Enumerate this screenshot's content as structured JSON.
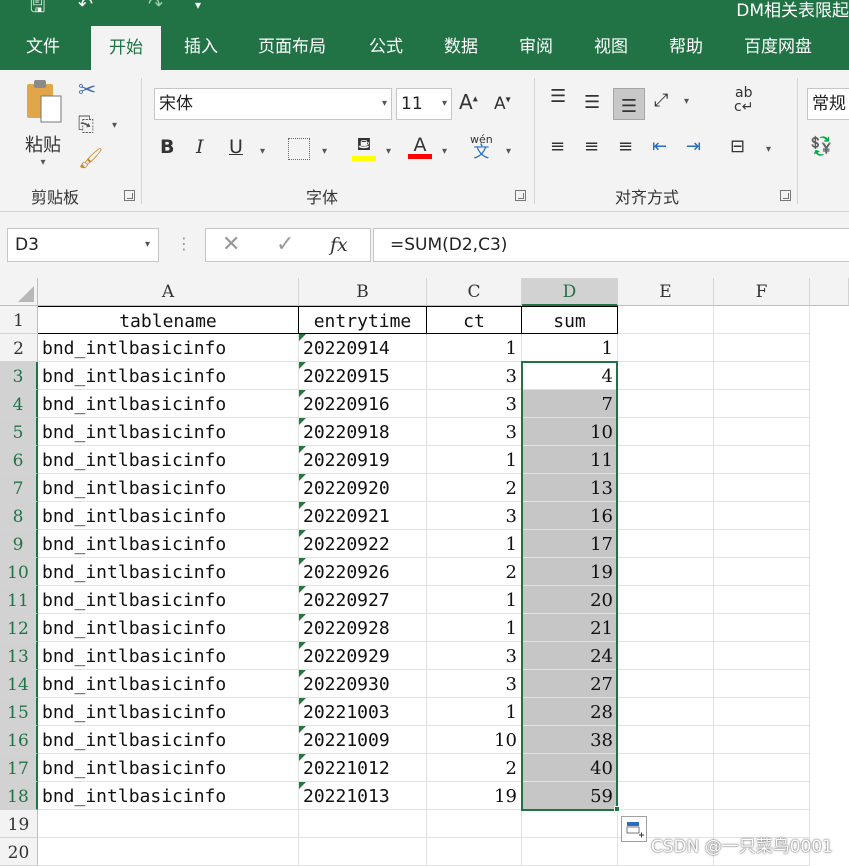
{
  "titlebar": {
    "title": "DM相关表限起"
  },
  "tabs": [
    "文件",
    "开始",
    "插入",
    "页面布局",
    "公式",
    "数据",
    "审阅",
    "视图",
    "帮助",
    "百度网盘"
  ],
  "active_tab": "开始",
  "ribbon": {
    "clipboard": {
      "paste_label": "粘贴",
      "group_label": "剪贴板"
    },
    "font": {
      "font_name": "宋体",
      "font_size": "11",
      "group_label": "字体",
      "phonetic": "wén",
      "phonetic_char": "文"
    },
    "alignment": {
      "group_label": "对齐方式"
    },
    "number": {
      "format": "常规"
    },
    "colors": {
      "accent": "#217346",
      "highlight": "#ffff00",
      "font_color": "#ff0000"
    }
  },
  "formula_bar": {
    "name_box": "D3",
    "formula": "=SUM(D2,C3)",
    "fx_label": "fx"
  },
  "columns": [
    "A",
    "B",
    "C",
    "D",
    "E",
    "F"
  ],
  "selected_column": "D",
  "headers": [
    "tablename",
    "entrytime",
    "ct",
    "sum"
  ],
  "rows": [
    [
      "bnd_intlbasicinfo",
      "20220914",
      "1",
      "1"
    ],
    [
      "bnd_intlbasicinfo",
      "20220915",
      "3",
      "4"
    ],
    [
      "bnd_intlbasicinfo",
      "20220916",
      "3",
      "7"
    ],
    [
      "bnd_intlbasicinfo",
      "20220918",
      "3",
      "10"
    ],
    [
      "bnd_intlbasicinfo",
      "20220919",
      "1",
      "11"
    ],
    [
      "bnd_intlbasicinfo",
      "20220920",
      "2",
      "13"
    ],
    [
      "bnd_intlbasicinfo",
      "20220921",
      "3",
      "16"
    ],
    [
      "bnd_intlbasicinfo",
      "20220922",
      "1",
      "17"
    ],
    [
      "bnd_intlbasicinfo",
      "20220926",
      "2",
      "19"
    ],
    [
      "bnd_intlbasicinfo",
      "20220927",
      "1",
      "20"
    ],
    [
      "bnd_intlbasicinfo",
      "20220928",
      "1",
      "21"
    ],
    [
      "bnd_intlbasicinfo",
      "20220929",
      "3",
      "24"
    ],
    [
      "bnd_intlbasicinfo",
      "20220930",
      "3",
      "27"
    ],
    [
      "bnd_intlbasicinfo",
      "20221003",
      "1",
      "28"
    ],
    [
      "bnd_intlbasicinfo",
      "20221009",
      "10",
      "38"
    ],
    [
      "bnd_intlbasicinfo",
      "20221012",
      "2",
      "40"
    ],
    [
      "bnd_intlbasicinfo",
      "20221013",
      "19",
      "59"
    ]
  ],
  "row_numbers": [
    "1",
    "2",
    "3",
    "4",
    "5",
    "6",
    "7",
    "8",
    "9",
    "10",
    "11",
    "12",
    "13",
    "14",
    "15",
    "16",
    "17",
    "18",
    "19",
    "20"
  ],
  "watermark": "CSDN @一只菜鸟0001"
}
